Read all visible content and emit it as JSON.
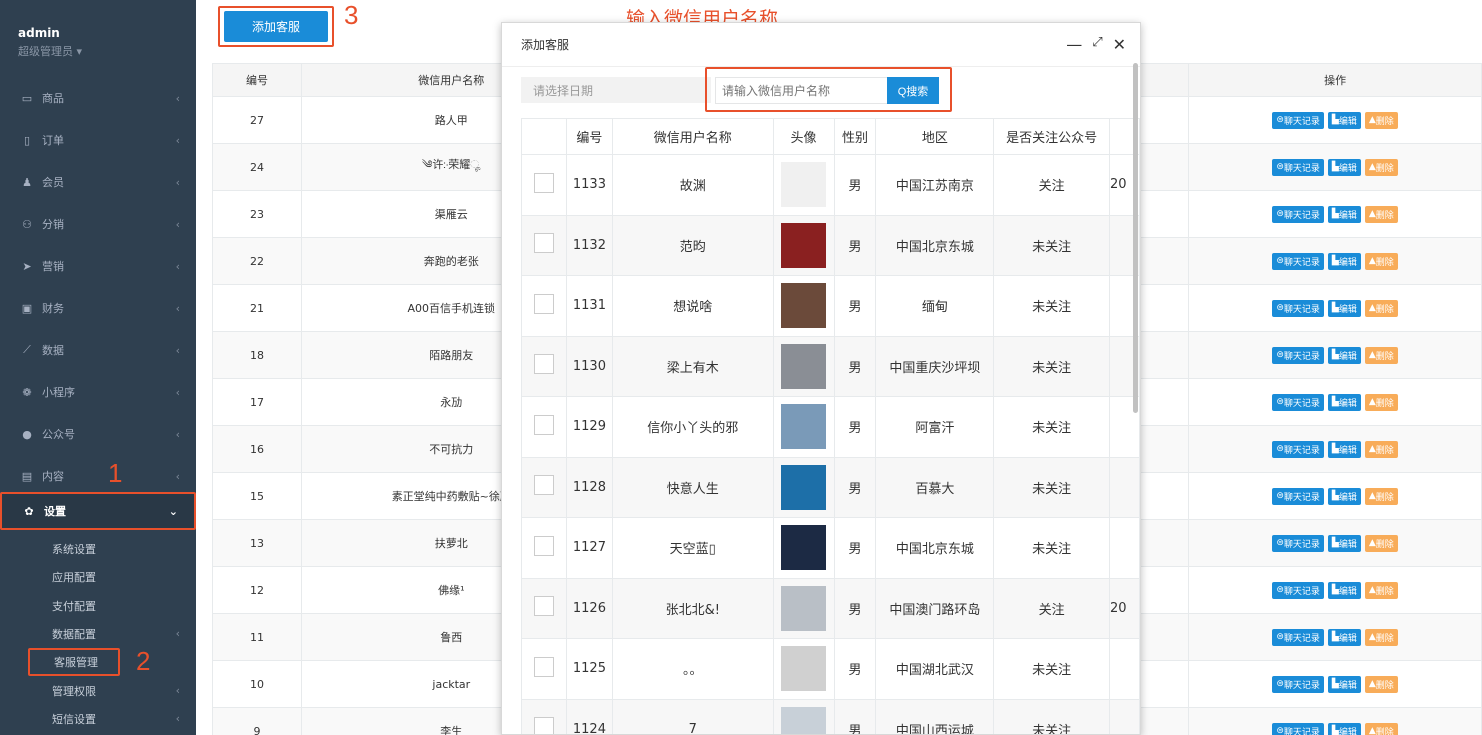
{
  "sidebar": {
    "user_name": "admin",
    "user_role": "超级管理员 ▾",
    "items": [
      {
        "label": "商品",
        "icon": "monitor-icon",
        "glyph": "▭"
      },
      {
        "label": "订单",
        "icon": "order-icon",
        "glyph": "▯"
      },
      {
        "label": "会员",
        "icon": "user-icon",
        "glyph": "♟"
      },
      {
        "label": "分销",
        "icon": "group-icon",
        "glyph": "⚇"
      },
      {
        "label": "营销",
        "icon": "send-icon",
        "glyph": "➤"
      },
      {
        "label": "财务",
        "icon": "money-icon",
        "glyph": "▣"
      },
      {
        "label": "数据",
        "icon": "chart-icon",
        "glyph": "⟋"
      },
      {
        "label": "小程序",
        "icon": "mini-program-icon",
        "glyph": "❁"
      },
      {
        "label": "公众号",
        "icon": "wechat-icon",
        "glyph": "●"
      },
      {
        "label": "内容",
        "icon": "book-icon",
        "glyph": "▤"
      },
      {
        "label": "设置",
        "icon": "gear-icon",
        "glyph": "✿"
      }
    ],
    "sub_items": [
      "系统设置",
      "应用配置",
      "支付配置",
      "数据配置",
      "客服管理",
      "管理权限",
      "短信设置"
    ]
  },
  "annotations": {
    "n1": "1",
    "n2": "2",
    "n3": "3",
    "hint": "输入微信用户名称"
  },
  "toolbar": {
    "add_label": "添加客服"
  },
  "main_table": {
    "headers": [
      "编号",
      "微信用户名称",
      "操作"
    ],
    "op_chat": "聊天记录",
    "op_edit": "编辑",
    "op_del": "删除",
    "rows": [
      {
        "id": "27",
        "name": "路人甲"
      },
      {
        "id": "24",
        "name": "༄许჻荣耀ೄ"
      },
      {
        "id": "23",
        "name": "渠雁云"
      },
      {
        "id": "22",
        "name": "奔跑的老张"
      },
      {
        "id": "21",
        "name": "A00百信手机连锁"
      },
      {
        "id": "18",
        "name": "陌路朋友"
      },
      {
        "id": "17",
        "name": "永劢"
      },
      {
        "id": "16",
        "name": "不可抗力"
      },
      {
        "id": "15",
        "name": "素正堂纯中药敷贴~徐蔚"
      },
      {
        "id": "13",
        "name": "扶萝北"
      },
      {
        "id": "12",
        "name": "佛缘¹"
      },
      {
        "id": "11",
        "name": "鲁西"
      },
      {
        "id": "10",
        "name": "jacktar"
      },
      {
        "id": "9",
        "name": "李生"
      }
    ]
  },
  "modal": {
    "title": "添加客服",
    "date_placeholder": "请选择日期",
    "search_placeholder": "请输入微信用户名称",
    "search_label": "Q搜索",
    "headers": [
      "编号",
      "微信用户名称",
      "头像",
      "性别",
      "地区",
      "是否关注公众号"
    ],
    "rows": [
      {
        "id": "1133",
        "name": "故渊",
        "sex": "男",
        "area": "中国江苏南京",
        "sub": "关注",
        "extra": "20",
        "avatar_color": "#f0f0f0"
      },
      {
        "id": "1132",
        "name": "范昀",
        "sex": "男",
        "area": "中国北京东城",
        "sub": "未关注",
        "extra": "",
        "avatar_color": "#8a2020"
      },
      {
        "id": "1131",
        "name": "想说啥",
        "sex": "男",
        "area": "缅甸",
        "sub": "未关注",
        "extra": "",
        "avatar_color": "#6b4a3a"
      },
      {
        "id": "1130",
        "name": "梁上有木",
        "sex": "男",
        "area": "中国重庆沙坪坝",
        "sub": "未关注",
        "extra": "",
        "avatar_color": "#8a8e95"
      },
      {
        "id": "1129",
        "name": "信你小丫头的邪",
        "sex": "男",
        "area": "阿富汗",
        "sub": "未关注",
        "extra": "",
        "avatar_color": "#7a9ab8"
      },
      {
        "id": "1128",
        "name": "快意人生",
        "sex": "男",
        "area": "百慕大",
        "sub": "未关注",
        "extra": "",
        "avatar_color": "#1d6fa8"
      },
      {
        "id": "1127",
        "name": "天空蓝▯",
        "sex": "男",
        "area": "中国北京东城",
        "sub": "未关注",
        "extra": "",
        "avatar_color": "#1c2a44"
      },
      {
        "id": "1126",
        "name": "张北北&!",
        "sex": "男",
        "area": "中国澳门路环岛",
        "sub": "关注",
        "extra": "20",
        "avatar_color": "#b9bfc6"
      },
      {
        "id": "1125",
        "name": "。。",
        "sex": "男",
        "area": "中国湖北武汉",
        "sub": "未关注",
        "extra": "",
        "avatar_color": "#d0d0d0"
      },
      {
        "id": "1124",
        "name": "7",
        "sex": "男",
        "area": "中国山西运城",
        "sub": "未关注",
        "extra": "",
        "avatar_color": "#c8d0d8"
      }
    ]
  },
  "colors": {
    "sidebar_bg": "#2f4050",
    "primary": "#1a8cd8",
    "warning": "#f8ac59",
    "annotation": "#e8502b"
  }
}
